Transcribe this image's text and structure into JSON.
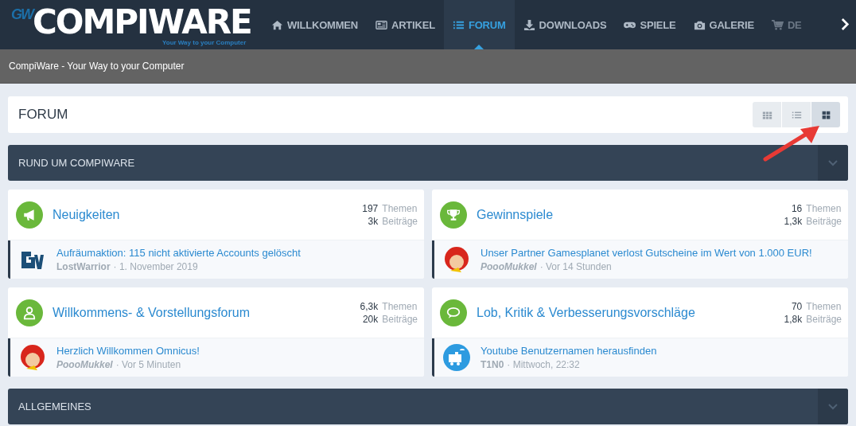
{
  "header": {
    "logo": {
      "mark": "GW",
      "name": "COMPIWARE",
      "tagline": "Your Way to your Computer"
    },
    "nav": [
      {
        "kind": "home",
        "label": "WILLKOMMEN",
        "selected": false
      },
      {
        "kind": "newspaper",
        "label": "ARTIKEL",
        "selected": false
      },
      {
        "kind": "list",
        "label": "FORUM",
        "selected": true
      },
      {
        "kind": "download",
        "label": "DOWNLOADS",
        "selected": false
      },
      {
        "kind": "gamepad",
        "label": "SPIELE",
        "selected": false
      },
      {
        "kind": "camera",
        "label": "GALERIE",
        "selected": false
      },
      {
        "kind": "cart",
        "label": "DE",
        "selected": false
      }
    ]
  },
  "breadcrumb": "CompiWare - Your Way to your Computer",
  "page_title": "FORUM",
  "view_modes": [
    {
      "kind": "grid",
      "selected": false
    },
    {
      "kind": "list",
      "selected": false
    },
    {
      "kind": "tiles",
      "selected": true
    }
  ],
  "sections": [
    {
      "title": "RUND UM COMPIWARE",
      "boards": [
        {
          "kind": "megaphone",
          "name": "Neuigkeiten",
          "topics": "197",
          "topics_label": "Themen",
          "posts": "3k",
          "posts_label": "Beiträge",
          "last_post": {
            "avatar": {
              "kind": "logo"
            },
            "title": "Aufräumaktion: 115 nicht aktivierte Accounts gelöscht",
            "author": "LostWarrior",
            "author_italic": false,
            "time": "· 1. November 2019"
          }
        },
        {
          "kind": "trophy",
          "name": "Gewinnspiele",
          "topics": "16",
          "topics_label": "Themen",
          "posts": "1,3k",
          "posts_label": "Beiträge",
          "last_post": {
            "avatar": {
              "kind": "mascot"
            },
            "title": "Unser Partner Gamesplanet verlost Gutscheine im Wert von 1.000 EUR!",
            "author": "PoooMukkel",
            "author_italic": true,
            "time": "· Vor 14 Stunden"
          }
        },
        {
          "kind": "user",
          "name": "Willkommens- & Vorstellungsforum",
          "topics": "6,3k",
          "topics_label": "Themen",
          "posts": "20k",
          "posts_label": "Beiträge",
          "last_post": {
            "avatar": {
              "kind": "mascot"
            },
            "title": "Herzlich Willkommen Omnicus!",
            "author": "PoooMukkel",
            "author_italic": true,
            "time": "· Vor 5 Minuten"
          }
        },
        {
          "kind": "speech",
          "name": "Lob, Kritik & Verbesserungsvorschläge",
          "topics": "70",
          "topics_label": "Themen",
          "posts": "1,8k",
          "posts_label": "Beiträge",
          "last_post": {
            "avatar": {
              "kind": "train"
            },
            "title": "Youtube Benutzernamen herausfinden",
            "author": "T1N0",
            "author_italic": false,
            "time": "· Mittwoch, 22:32"
          }
        }
      ]
    },
    {
      "title": "ALLGEMEINES"
    }
  ]
}
